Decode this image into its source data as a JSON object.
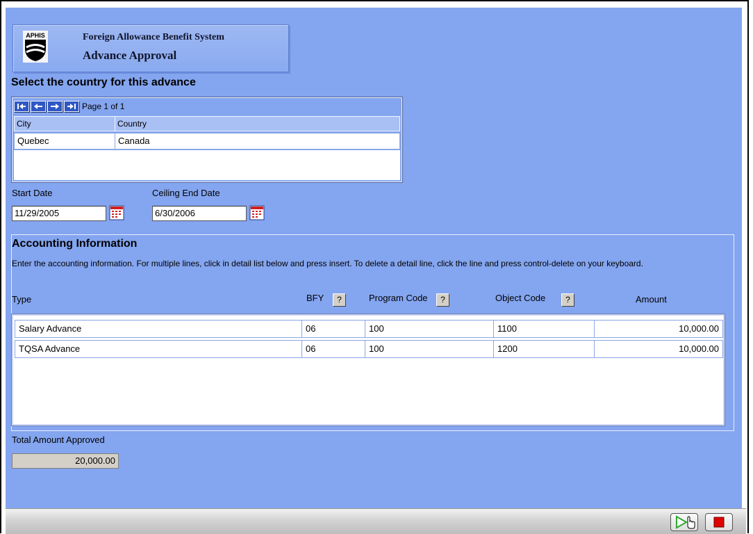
{
  "header": {
    "logo_text": "APHIS",
    "system_name": "Foreign Allowance Benefit System",
    "screen_title": "Advance Approval"
  },
  "country_section": {
    "title": "Select the country for this advance",
    "pager_text": "Page 1 of 1",
    "columns": [
      "City",
      "Country"
    ],
    "rows": [
      {
        "city": "Quebec",
        "country": "Canada"
      }
    ]
  },
  "dates": {
    "start_label": "Start Date",
    "start_value": "11/29/2005",
    "ceiling_label": "Ceiling End Date",
    "ceiling_value": "6/30/2006"
  },
  "accounting": {
    "title": "Accounting Information",
    "instructions": "Enter the accounting information. For multiple lines, click in detail list below and press insert. To delete a detail line, click the line and press control-delete on your keyboard.",
    "columns": {
      "type": "Type",
      "bfy": "BFY",
      "program_code": "Program Code",
      "object_code": "Object Code",
      "amount": "Amount"
    },
    "help_glyph": "?",
    "rows": [
      {
        "type": "Salary Advance",
        "bfy": "06",
        "program_code": "100",
        "object_code": "1100",
        "amount": "10,000.00"
      },
      {
        "type": "TQSA Advance",
        "bfy": "06",
        "program_code": "100",
        "object_code": "1200",
        "amount": "10,000.00"
      }
    ]
  },
  "total": {
    "label": "Total Amount Approved",
    "value": "20,000.00"
  },
  "colors": {
    "background": "#84a5ef",
    "nav_button": "#2f57c4",
    "stop_red": "#e00000",
    "go_green": "#2fa830"
  }
}
